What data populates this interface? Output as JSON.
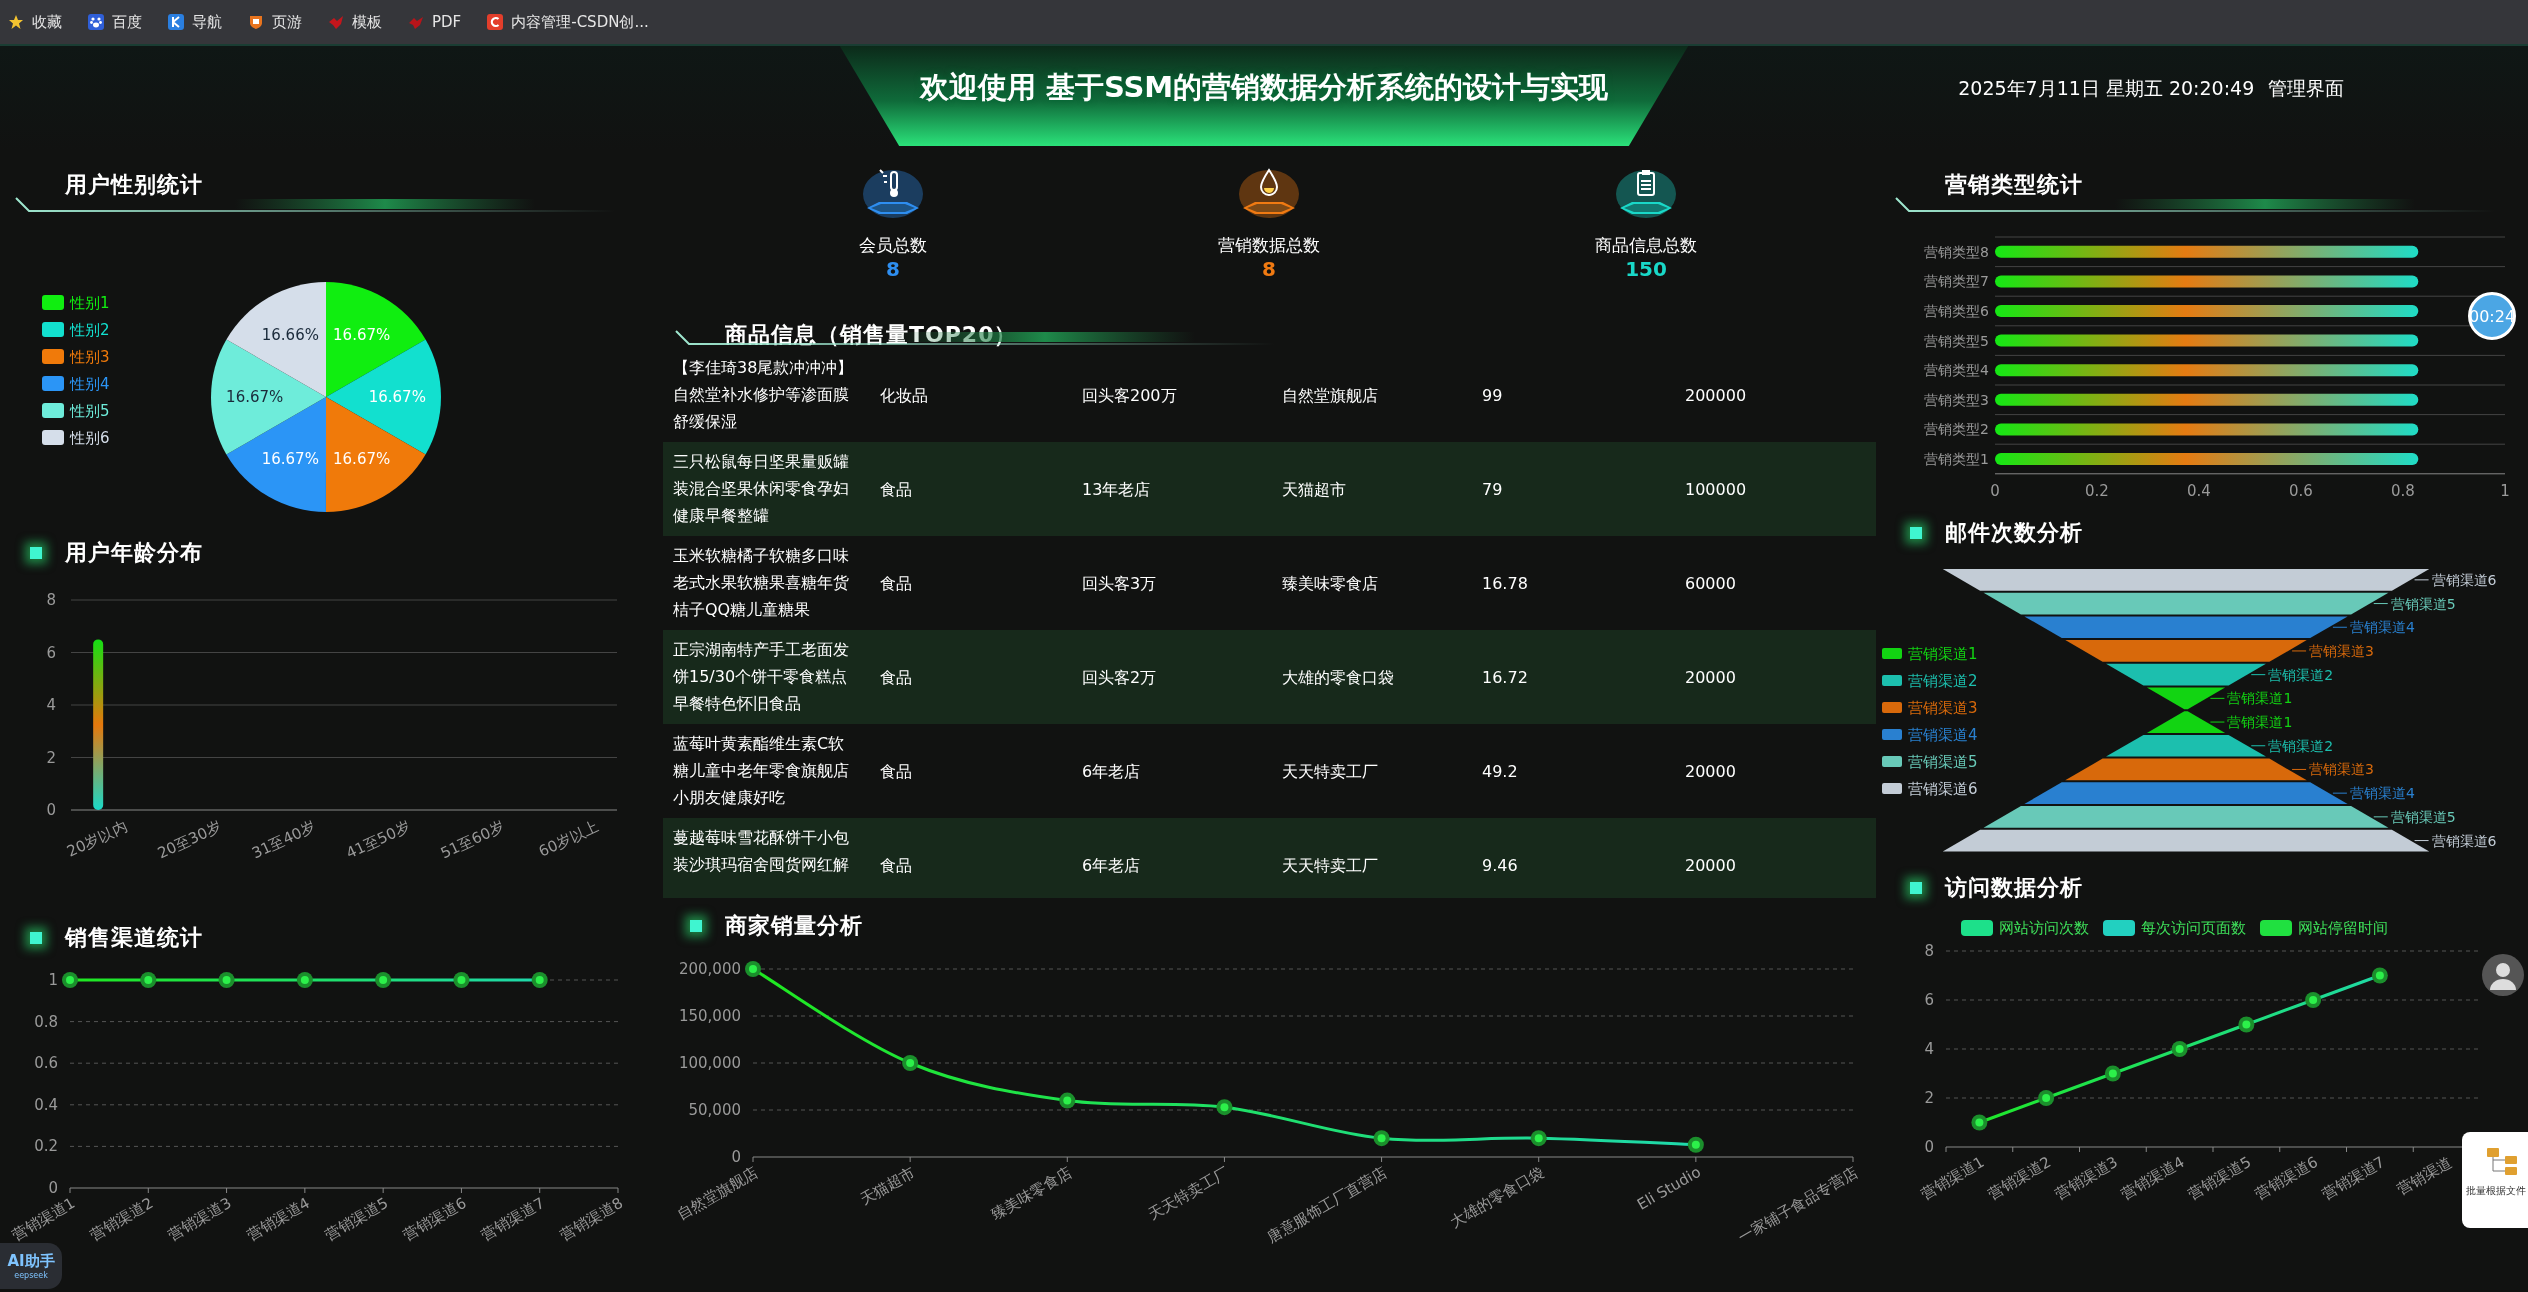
{
  "bookmarks": [
    {
      "label": "收藏",
      "kind": "star"
    },
    {
      "label": "百度",
      "kind": "paw"
    },
    {
      "label": "导航",
      "kind": "nav"
    },
    {
      "label": "页游",
      "kind": "game"
    },
    {
      "label": "模板",
      "kind": "bird"
    },
    {
      "label": "PDF",
      "kind": "pdf"
    },
    {
      "label": "内容管理-CSDN创...",
      "kind": "csdn"
    }
  ],
  "header": {
    "title": "欢迎使用 基于SSM的营销数据分析系统的设计与实现",
    "datetime": "2025年7月11日 星期五 20:20:49",
    "link": "管理界面"
  },
  "gender_panel": {
    "title": {
      "text": "用户性别统计",
      "kind": "bracket"
    },
    "slices": [
      {
        "color": "#10ee10"
      },
      {
        "color": "#12e0cf"
      },
      {
        "color": "#f07a0a"
      },
      {
        "color": "#2b95f6"
      },
      {
        "color": "#6eecda"
      },
      {
        "color": "#d5deea"
      }
    ],
    "chart_data": {
      "type": "pie",
      "legend": "left",
      "categories": [
        "性别1",
        "性别2",
        "性别3",
        "性别4",
        "性别5",
        "性别6"
      ],
      "values": [
        16.67,
        16.67,
        16.67,
        16.67,
        16.67,
        16.66
      ],
      "value_labels": [
        "16.67%",
        "16.67%",
        "16.67%",
        "16.67%",
        "16.67%",
        "16.66%"
      ]
    }
  },
  "age_panel": {
    "title": {
      "text": "用户年龄分布",
      "kind": "square"
    },
    "chart_data": {
      "type": "bar",
      "grid": true,
      "categories": [
        "20岁以内",
        "20至30岁",
        "31至40岁",
        "41至50岁",
        "51至60岁",
        "60岁以上"
      ],
      "values": [
        6.5,
        0,
        0,
        0,
        0,
        0
      ],
      "ylim": [
        0,
        8
      ],
      "yticks": [
        0,
        2,
        4,
        6,
        8
      ]
    }
  },
  "channel_panel": {
    "title": {
      "text": "销售渠道统计",
      "kind": "square"
    },
    "chart_data": {
      "type": "line",
      "grid": true,
      "marker": true,
      "categories": [
        "营销渠道1",
        "营销渠道2",
        "营销渠道3",
        "营销渠道4",
        "营销渠道5",
        "营销渠道6",
        "营销渠道7",
        "营销渠道8"
      ],
      "values": [
        1,
        1,
        1,
        1,
        1,
        1,
        1,
        null
      ],
      "ylim": [
        0,
        1
      ],
      "yticks": [
        0,
        0.2,
        0.4,
        0.6,
        0.8,
        1
      ]
    }
  },
  "stats": [
    {
      "label": "会员总数",
      "value": "8",
      "kind": "thermometer",
      "color": "#2e8ef0"
    },
    {
      "label": "营销数据总数",
      "value": "8",
      "kind": "droplet",
      "color": "#f07a12"
    },
    {
      "label": "商品信息总数",
      "value": "150",
      "kind": "clipboard",
      "color": "#19d8c8"
    }
  ],
  "products": {
    "title": {
      "text": "商品信息（销售量TOP20）",
      "kind": "bracket"
    },
    "rows": [
      [
        "【李佳琦38尾款冲冲冲】自然堂补水修护等渗面膜舒缓保湿",
        "化妆品",
        "回头客200万",
        "自然堂旗舰店",
        "99",
        "200000"
      ],
      [
        "三只松鼠每日坚果量贩罐装混合坚果休闲零食孕妇健康早餐整罐",
        "食品",
        "13年老店",
        "天猫超市",
        "79",
        "100000"
      ],
      [
        "玉米软糖橘子软糖多口味老式水果软糖果喜糖年货桔子QQ糖儿童糖果",
        "食品",
        "回头客3万",
        "臻美味零食店",
        "16.78",
        "60000"
      ],
      [
        "正宗湖南特产手工老面发饼15/30个饼干零食糕点早餐特色怀旧食品",
        "食品",
        "回头客2万",
        "大雄的零食口袋",
        "16.72",
        "20000"
      ],
      [
        "蓝莓叶黄素酯维生素C软糖儿童中老年零食旗舰店小朋友健康好吃",
        "食品",
        "6年老店",
        "天天特卖工厂",
        "49.2",
        "20000"
      ],
      [
        "蔓越莓味雪花酥饼干小包装沙琪玛宿舍囤货网红解",
        "食品",
        "6年老店",
        "天天特卖工厂",
        "9.46",
        "20000"
      ]
    ]
  },
  "merchant_panel": {
    "title": {
      "text": "商家销量分析",
      "kind": "square"
    },
    "chart_data": {
      "type": "line",
      "grid": true,
      "marker": true,
      "categories": [
        "自然堂旗舰店",
        "天猫超市",
        "臻美味零食店",
        "天天特卖工厂",
        "唐意服饰工厂直营店",
        "大雄的零食口袋",
        "Eli Studio",
        "一家铺子食品专营店"
      ],
      "values": [
        200000,
        100000,
        60000,
        53000,
        20000,
        20000,
        13000,
        null
      ],
      "ylim": [
        0,
        200000
      ],
      "yticks": [
        0,
        {
          "value": 50000,
          "label": "50,000"
        },
        {
          "value": 100000,
          "label": "100,000"
        },
        {
          "value": 150000,
          "label": "150,000"
        },
        {
          "value": 200000,
          "label": "200,000"
        }
      ]
    }
  },
  "type_panel": {
    "title": {
      "text": "营销类型统计",
      "kind": "bracket"
    },
    "chart_data": {
      "type": "bar",
      "orientation": "horizontal",
      "grid": true,
      "categories": [
        "营销类型8",
        "营销类型7",
        "营销类型6",
        "营销类型5",
        "营销类型4",
        "营销类型3",
        "营销类型2",
        "营销类型1"
      ],
      "values": [
        0.83,
        0.83,
        0.83,
        0.83,
        0.83,
        0.83,
        0.83,
        0.83
      ],
      "xlim": [
        0,
        1
      ],
      "xticks": [
        0,
        0.2,
        0.4,
        0.6,
        0.8,
        1
      ]
    }
  },
  "mail_panel": {
    "title": {
      "text": "邮件次数分析",
      "kind": "square"
    },
    "legend": [
      {
        "label": "营销渠道1",
        "color": "#12d412"
      },
      {
        "label": "营销渠道2",
        "color": "#1cbfae"
      },
      {
        "label": "营销渠道3",
        "color": "#d8690b"
      },
      {
        "label": "营销渠道4",
        "color": "#2980d0"
      },
      {
        "label": "营销渠道5",
        "color": "#68c9b8"
      },
      {
        "label": "营销渠道6",
        "color": "#c3ccd6"
      }
    ],
    "top_stages": [
      {
        "label": "营销渠道6",
        "color": "#c3ccd6"
      },
      {
        "label": "营销渠道5",
        "color": "#68c9b8"
      },
      {
        "label": "营销渠道4",
        "color": "#2980d0"
      },
      {
        "label": "营销渠道3",
        "color": "#d8690b"
      },
      {
        "label": "营销渠道2",
        "color": "#1cbfae"
      },
      {
        "label": "营销渠道1",
        "color": "#12d412"
      }
    ],
    "bottom_stages": [
      {
        "label": "营销渠道1",
        "color": "#12d412"
      },
      {
        "label": "营销渠道2",
        "color": "#1cbfae"
      },
      {
        "label": "营销渠道3",
        "color": "#d8690b"
      },
      {
        "label": "营销渠道4",
        "color": "#2980d0"
      },
      {
        "label": "营销渠道5",
        "color": "#68c9b8"
      },
      {
        "label": "营销渠道6",
        "color": "#c3ccd6"
      }
    ]
  },
  "visit_panel": {
    "title": {
      "text": "访问数据分析",
      "kind": "square"
    },
    "legend": [
      {
        "label": "网站访问次数",
        "color": "#1de08a"
      },
      {
        "label": "每次访问页面数",
        "color": "#22d0c0"
      },
      {
        "label": "网站停留时间",
        "color": "#20e040"
      }
    ],
    "chart_data": {
      "type": "line",
      "grid": true,
      "marker": true,
      "categories": [
        "营销渠道1",
        "营销渠道2",
        "营销渠道3",
        "营销渠道4",
        "营销渠道5",
        "营销渠道6",
        "营销渠道7",
        "营销渠道"
      ],
      "values": [
        1,
        2,
        3,
        4,
        5,
        6,
        7,
        null
      ],
      "ylim": [
        0,
        8
      ],
      "yticks": [
        0,
        2,
        4,
        6,
        8
      ]
    }
  },
  "overlays": {
    "timer": "00:24",
    "assistant": "AI助手",
    "assistant_sub": "eepseek",
    "file_tool": "批量根据文件"
  }
}
